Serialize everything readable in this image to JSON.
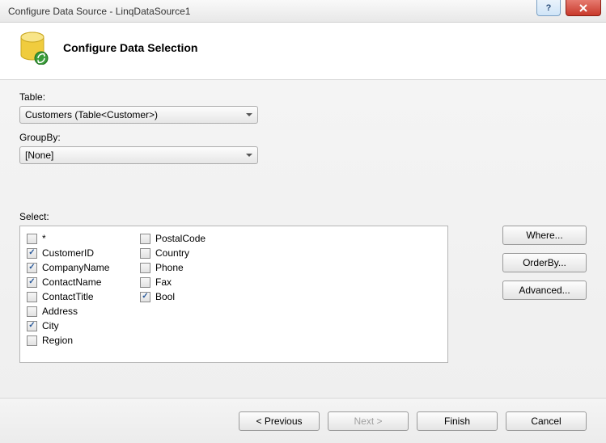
{
  "window": {
    "title": "Configure Data Source - LinqDataSource1",
    "heading": "Configure Data Selection"
  },
  "labels": {
    "table": "Table:",
    "groupby": "GroupBy:",
    "select": "Select:"
  },
  "table_combo": "Customers (Table<Customer>)",
  "groupby_combo": "[None]",
  "fields": [
    {
      "label": "*",
      "checked": false
    },
    {
      "label": "CustomerID",
      "checked": true
    },
    {
      "label": "CompanyName",
      "checked": true
    },
    {
      "label": "ContactName",
      "checked": true
    },
    {
      "label": "ContactTitle",
      "checked": false
    },
    {
      "label": "Address",
      "checked": false
    },
    {
      "label": "City",
      "checked": true
    },
    {
      "label": "Region",
      "checked": false
    },
    {
      "label": "PostalCode",
      "checked": false
    },
    {
      "label": "Country",
      "checked": false
    },
    {
      "label": "Phone",
      "checked": false
    },
    {
      "label": "Fax",
      "checked": false
    },
    {
      "label": "Bool",
      "checked": true
    }
  ],
  "side_buttons": {
    "where": "Where...",
    "orderby": "OrderBy...",
    "advanced": "Advanced..."
  },
  "footer": {
    "previous": "< Previous",
    "next": "Next >",
    "finish": "Finish",
    "cancel": "Cancel"
  }
}
